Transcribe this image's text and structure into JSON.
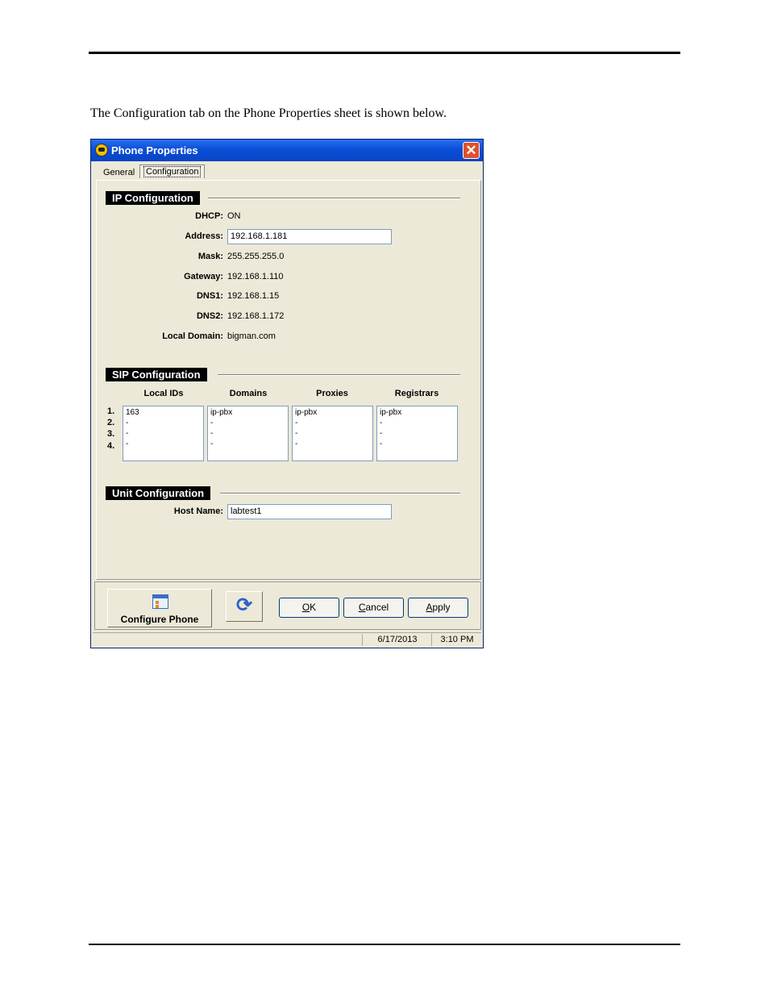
{
  "intro": "The Configuration tab on the Phone Properties sheet is shown below.",
  "window": {
    "title": "Phone Properties",
    "close_glyph": "✕",
    "tabs": [
      "General",
      "Configuration"
    ]
  },
  "ip_config": {
    "heading": "IP Configuration",
    "dhcp_label": "DHCP:",
    "dhcp_value": "ON",
    "address_label": "Address:",
    "address_value": "192.168.1.181",
    "mask_label": "Mask:",
    "mask_value": "255.255.255.0",
    "gateway_label": "Gateway:",
    "gateway_value": "192.168.1.110",
    "dns1_label": "DNS1:",
    "dns1_value": "192.168.1.15",
    "dns2_label": "DNS2:",
    "dns2_value": "192.168.1.172",
    "domain_label": "Local Domain:",
    "domain_value": "bigman.com"
  },
  "sip_config": {
    "heading": "SIP Configuration",
    "columns": [
      "Local IDs",
      "Domains",
      "Proxies",
      "Registrars"
    ],
    "row_numbers": [
      "1.",
      "2.",
      "3.",
      "4."
    ],
    "local_ids": [
      "163",
      "-",
      "-",
      "-"
    ],
    "domains": [
      "ip-pbx",
      "-",
      "-",
      "-"
    ],
    "proxies": [
      "ip-pbx",
      "-",
      "-",
      "-"
    ],
    "registrars": [
      "ip-pbx",
      "-",
      "-",
      "-"
    ]
  },
  "unit_config": {
    "heading": "Unit Configuration",
    "host_label": "Host Name:",
    "host_value": "labtest1"
  },
  "buttons": {
    "configure_phone": "Configure Phone",
    "refresh_icon": "refresh-icon",
    "ok_accel": "O",
    "ok_rest": "K",
    "cancel_accel": "C",
    "cancel_rest": "ancel",
    "apply_accel": "A",
    "apply_rest": "pply"
  },
  "status": {
    "date": "6/17/2013",
    "time": "3:10 PM"
  }
}
